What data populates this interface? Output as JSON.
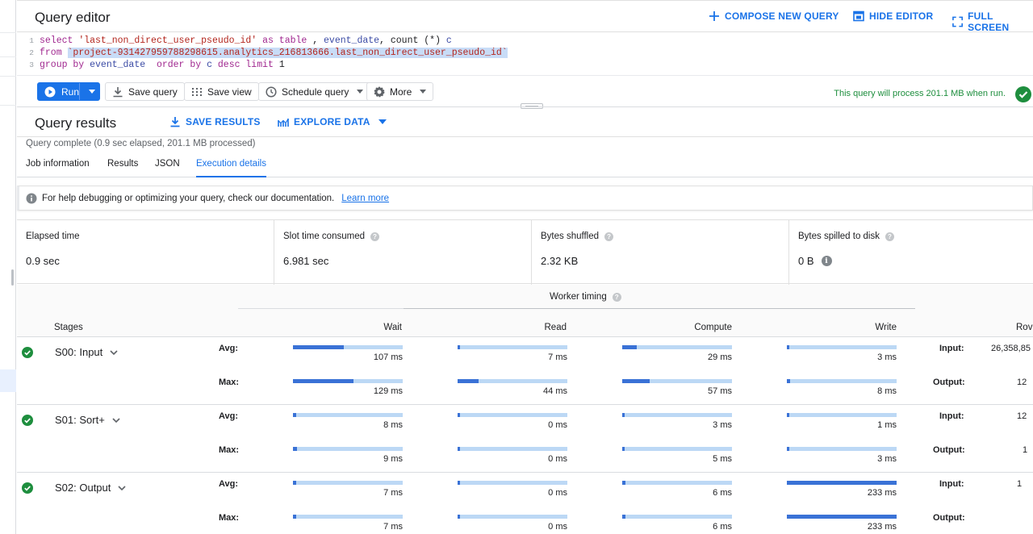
{
  "header": {
    "title": "Query editor",
    "compose_label": "COMPOSE NEW QUERY",
    "hide_label": "HIDE EDITOR",
    "fullscreen_label": "FULL SCREEN"
  },
  "code": {
    "line_numbers": [
      "1",
      "2",
      "3"
    ],
    "line1": {
      "kw1": "select",
      "str1": "'last_non_direct_user_pseudo_id'",
      "kw2": "as",
      "kw3": "table",
      "sep": ",",
      "id1": "event_date",
      "sep2": ",",
      "id2": "count",
      "op": "(*)",
      "id3": "c"
    },
    "line2": {
      "kw1": "from",
      "table": "`project-931427959788298615.analytics_216813666.last_non_direct_user_pseudo_id`"
    },
    "line3": {
      "kw1": "group by",
      "id1": "event_date",
      "kw2": "order by",
      "id2": "c",
      "kw3": "desc",
      "kw4": "limit",
      "num": "1"
    }
  },
  "toolbar": {
    "run_label": "Run",
    "save_query_label": "Save query",
    "save_view_label": "Save view",
    "schedule_label": "Schedule query",
    "more_label": "More",
    "validator_text": "This query will process 201.1 MB when run."
  },
  "results": {
    "title": "Query results",
    "save_label": "SAVE RESULTS",
    "explore_label": "EXPLORE DATA",
    "status": "Query complete (0.9 sec elapsed, 201.1 MB processed)",
    "tabs": [
      "Job information",
      "Results",
      "JSON",
      "Execution details"
    ],
    "info_text": "For help debugging or optimizing your query, check our documentation.",
    "info_link": "Learn more"
  },
  "stats": [
    {
      "label": "Elapsed time",
      "value": "0.9 sec"
    },
    {
      "label": "Slot time consumed",
      "value": "6.981 sec"
    },
    {
      "label": "Bytes shuffled",
      "value": "2.32 KB"
    },
    {
      "label": "Bytes spilled to disk",
      "value": "0 B"
    }
  ],
  "execution": {
    "worker_timing_label": "Worker timing",
    "stages_header": "Stages",
    "columns": [
      "Wait",
      "Read",
      "Compute",
      "Write"
    ],
    "rows_header": "Rov",
    "avg_label": "Avg:",
    "max_label": "Max:",
    "input_label": "Input:",
    "output_label": "Output:",
    "stages": [
      {
        "name": "S00: Input",
        "avg": [
          {
            "v": "107 ms",
            "f": 0.46
          },
          {
            "v": "7 ms",
            "f": 0.02
          },
          {
            "v": "29 ms",
            "f": 0.13
          },
          {
            "v": "3 ms",
            "f": 0.01
          }
        ],
        "max": [
          {
            "v": "129 ms",
            "f": 0.55
          },
          {
            "v": "44 ms",
            "f": 0.19
          },
          {
            "v": "57 ms",
            "f": 0.25
          },
          {
            "v": "8 ms",
            "f": 0.03
          }
        ],
        "input_rows": "26,358,85",
        "output_rows": "12"
      },
      {
        "name": "S01: Sort+",
        "avg": [
          {
            "v": "8 ms",
            "f": 0.03
          },
          {
            "v": "0 ms",
            "f": 0
          },
          {
            "v": "3 ms",
            "f": 0.01
          },
          {
            "v": "1 ms",
            "f": 0.004
          }
        ],
        "max": [
          {
            "v": "9 ms",
            "f": 0.04
          },
          {
            "v": "0 ms",
            "f": 0
          },
          {
            "v": "5 ms",
            "f": 0.02
          },
          {
            "v": "3 ms",
            "f": 0.01
          }
        ],
        "input_rows": "12",
        "output_rows": "1"
      },
      {
        "name": "S02: Output",
        "avg": [
          {
            "v": "7 ms",
            "f": 0.03
          },
          {
            "v": "0 ms",
            "f": 0
          },
          {
            "v": "6 ms",
            "f": 0.03
          },
          {
            "v": "233 ms",
            "f": 1.0
          }
        ],
        "max": [
          {
            "v": "7 ms",
            "f": 0.03
          },
          {
            "v": "0 ms",
            "f": 0
          },
          {
            "v": "6 ms",
            "f": 0.03
          },
          {
            "v": "233 ms",
            "f": 1.0
          }
        ],
        "input_rows": "1",
        "output_rows": ""
      }
    ]
  },
  "colors": {
    "accent": "#1a73e8",
    "success": "#1e8e3e",
    "bar_fill": "#3a72d6",
    "bar_track": "#bcd8f5"
  }
}
